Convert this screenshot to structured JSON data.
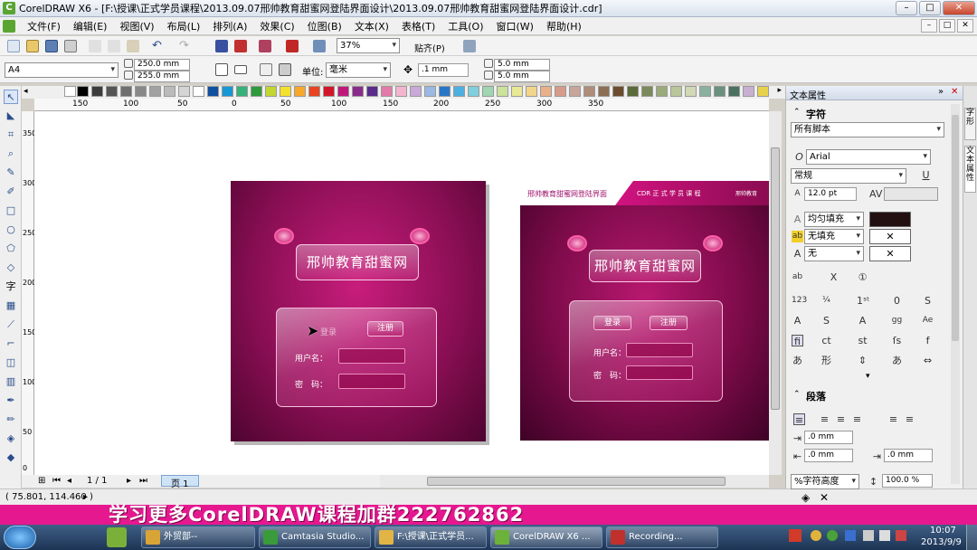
{
  "window": {
    "title": "CorelDRAW X6 - [F:\\授课\\正式学员课程\\2013.09.07邢帅教育甜蜜网登陆界面设计\\2013.09.07邢帅教育甜蜜网登陆界面设计.cdr]",
    "min": "–",
    "max": "□",
    "close": "✕"
  },
  "menu": [
    "文件(F)",
    "编辑(E)",
    "视图(V)",
    "布局(L)",
    "排列(A)",
    "效果(C)",
    "位图(B)",
    "文本(X)",
    "表格(T)",
    "工具(O)",
    "窗口(W)",
    "帮助(H)"
  ],
  "toolbar1": {
    "zoom": "37%",
    "snap": "贴齐(P)"
  },
  "toolbar2": {
    "page_size": "A4",
    "width": "250.0 mm",
    "height": "255.0 mm",
    "unit_label": "单位:",
    "unit": "毫米",
    "nudge": ".1 mm",
    "dup_x": "5.0 mm",
    "dup_y": "5.0 mm"
  },
  "ruler": {
    "h_ticks": [
      "150",
      "100",
      "50",
      "0",
      "50",
      "100",
      "150",
      "200",
      "250",
      "300",
      "350"
    ],
    "v_ticks": [
      "350",
      "300",
      "250",
      "200",
      "150",
      "100",
      "50",
      "0"
    ]
  },
  "canvas": {
    "left_design": {
      "logo": "邢帅教育甜蜜网",
      "login_tab": "登录",
      "register_tab": "注册",
      "username_label": "用户名：",
      "password_label": "密　码："
    },
    "right_design": {
      "header_left": "邢帅教育甜蜜网登陆界面",
      "header_right": "CDR 正 式 学 员 课 程",
      "header_brand": "邢帅教育",
      "logo": "邢帅教育甜蜜网",
      "login_tab": "登录",
      "register_tab": "注册",
      "username_label": "用户名：",
      "password_label": "密　码："
    }
  },
  "page_nav": {
    "counter": "1 / 1",
    "tab": "页 1"
  },
  "status": {
    "coords": "( 75.801, 114.460 )"
  },
  "panel": {
    "title": "文本属性",
    "section_char": "字符",
    "script": "所有脚本",
    "font": "Arial",
    "style": "常规",
    "size": "12.0 pt",
    "fill": "均匀填充",
    "bg_fill": "无填充",
    "outline": "无",
    "section_para": "段落",
    "indent1": ".0 mm",
    "indent2": ".0 mm",
    "indent3": ".0 mm",
    "line_spacing_mode": "%字符高度",
    "line_spacing": "100.0 %",
    "side_tabs": [
      "字形",
      "文本属性"
    ]
  },
  "banner": {
    "text": "学习更多CorelDRAW课程加群222762862"
  },
  "taskbar": {
    "items": [
      "外贸部--",
      "Camtasia Studio...",
      "F:\\授课\\正式学员...",
      "CorelDRAW X6 ...",
      "Recording..."
    ],
    "time": "10:07",
    "date": "2013/9/9"
  },
  "colors": {
    "accent_magenta": "#e6188f",
    "design_bg_dark": "#5a0533",
    "design_bg_mid": "#b0166e"
  }
}
